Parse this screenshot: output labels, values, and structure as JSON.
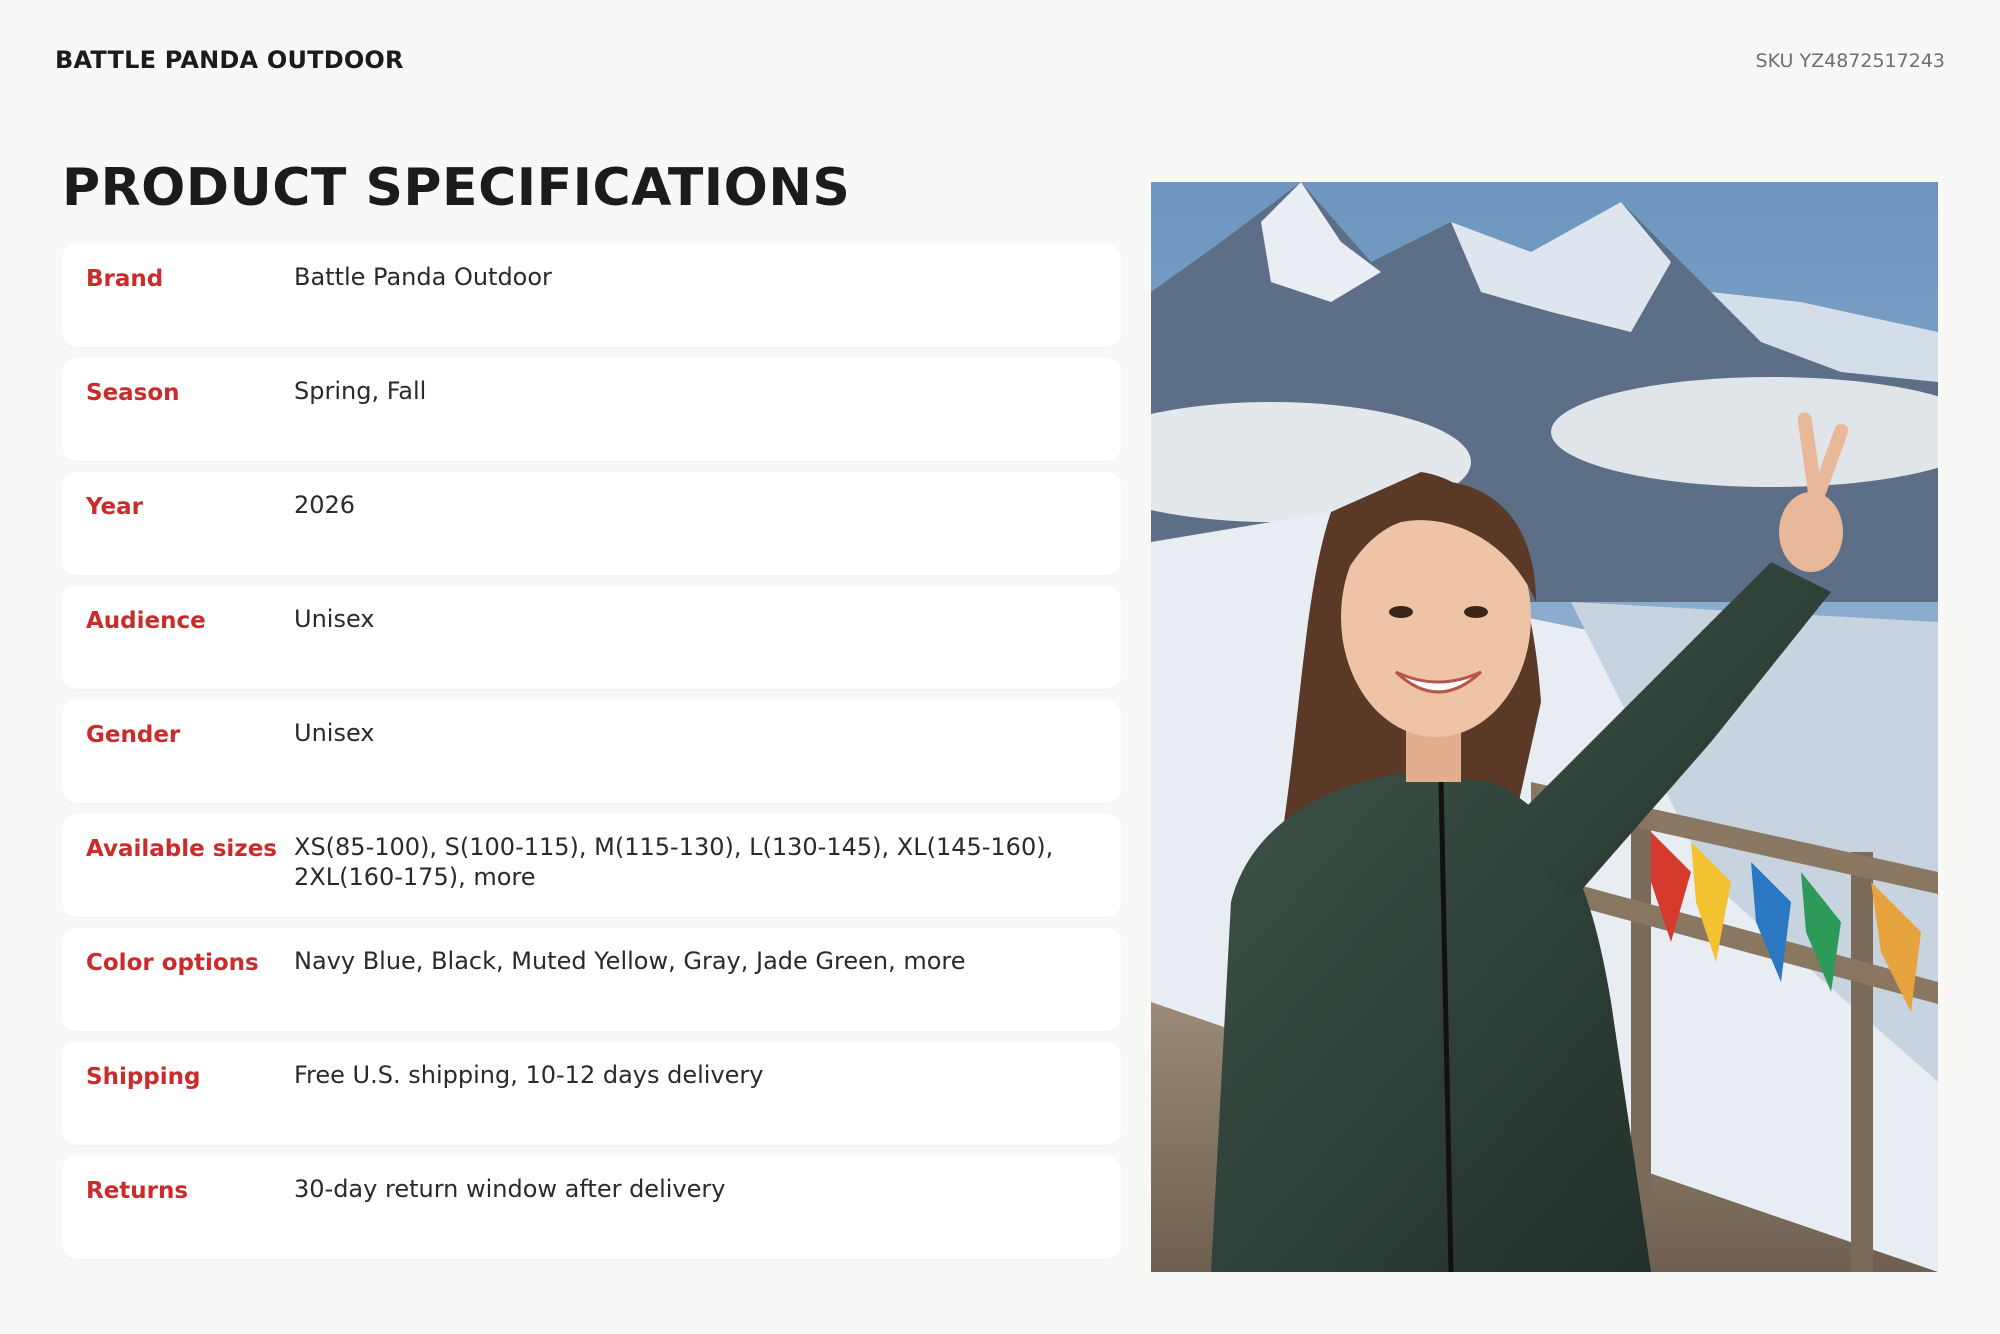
{
  "header": {
    "brand": "BATTLE PANDA OUTDOOR",
    "sku": "SKU YZ4872517243"
  },
  "page_title": "PRODUCT SPECIFICATIONS",
  "specs": [
    {
      "label": "Brand",
      "value": "Battle Panda Outdoor"
    },
    {
      "label": "Season",
      "value": "Spring, Fall"
    },
    {
      "label": "Year",
      "value": "2026"
    },
    {
      "label": "Audience",
      "value": "Unisex"
    },
    {
      "label": "Gender",
      "value": "Unisex"
    },
    {
      "label": "Available sizes",
      "value": "XS(85-100), S(100-115), M(115-130), L(130-145), XL(145-160), 2XL(160-175), more"
    },
    {
      "label": "Color options",
      "value": "Navy Blue, Black, Muted Yellow, Gray, Jade Green, more"
    },
    {
      "label": "Shipping",
      "value": "Free U.S. shipping, 10-12 days delivery"
    },
    {
      "label": "Returns",
      "value": "30-day return window after delivery"
    }
  ],
  "colors": {
    "label_accent": "#cc2b2b",
    "background": "#f8f8f6",
    "card": "#ffffff"
  }
}
